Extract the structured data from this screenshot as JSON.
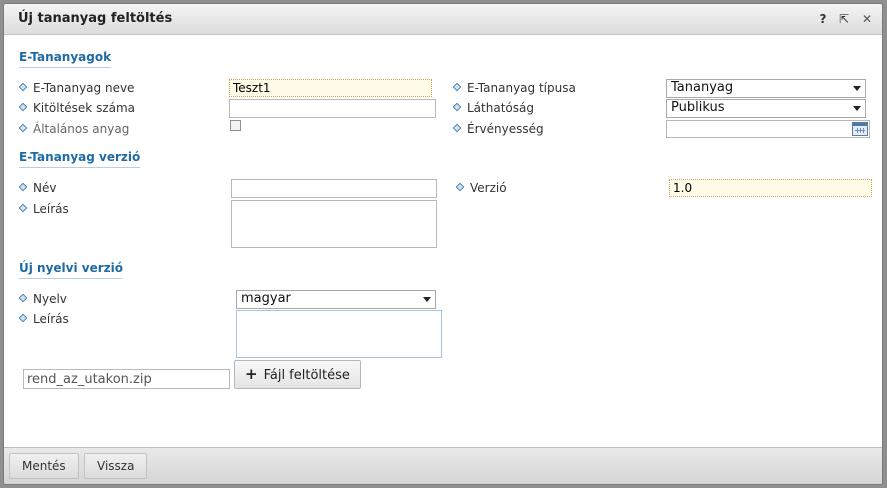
{
  "dialog": {
    "title": "Új tananyag feltöltés",
    "icons": [
      "help-icon",
      "popout-icon",
      "close-icon"
    ],
    "help_glyph": "?",
    "popout_glyph": "⇱",
    "close_glyph": "✕"
  },
  "sections": {
    "materials": "E-Tananyagok",
    "version": "E-Tananyag verzió",
    "language": "Új nyelvi verzió"
  },
  "materials": {
    "name_label": "E-Tananyag neve",
    "name_value": "Teszt1",
    "completions_label": "Kitöltések száma",
    "completions_value": "",
    "general_label": "Általános anyag",
    "type_label": "E-Tananyag típusa",
    "type_value": "Tananyag",
    "visibility_label": "Láthatóság",
    "visibility_value": "Publikus",
    "validity_label": "Érvényesség",
    "validity_value": ""
  },
  "version": {
    "name_label": "Név",
    "name_value": "",
    "description_label": "Leírás",
    "version_label": "Verzió",
    "version_value": "1.0"
  },
  "language": {
    "language_label": "Nyelv",
    "language_value": "magyar",
    "description_label": "Leírás"
  },
  "upload": {
    "file_name": "rend_az_utakon.zip",
    "button_label": "Fájl feltöltése"
  },
  "footer": {
    "save_label": "Mentés",
    "back_label": "Vissza"
  },
  "colors": {
    "section_title": "#1e6aa6",
    "required_field_bg": "#fffbe6"
  }
}
